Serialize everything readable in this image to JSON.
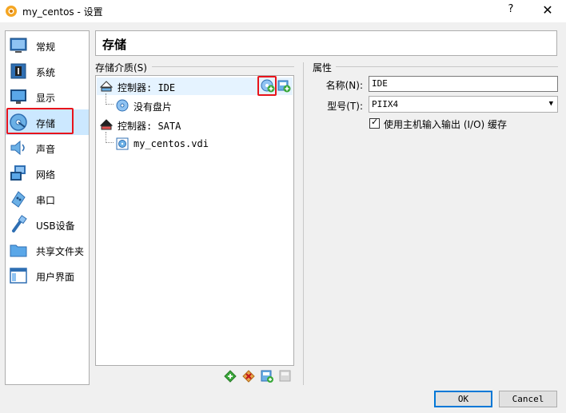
{
  "window": {
    "title": "my_centos - 设置",
    "help_label": "?",
    "close_label": "✕"
  },
  "sidebar": {
    "items": [
      {
        "label": "常规",
        "icon": "general-icon"
      },
      {
        "label": "系统",
        "icon": "system-chip-icon"
      },
      {
        "label": "显示",
        "icon": "display-monitor-icon"
      },
      {
        "label": "存储",
        "icon": "storage-disk-icon",
        "selected": true
      },
      {
        "label": "声音",
        "icon": "speaker-icon"
      },
      {
        "label": "网络",
        "icon": "network-icon"
      },
      {
        "label": "串口",
        "icon": "serial-port-icon"
      },
      {
        "label": "USB设备",
        "icon": "usb-icon"
      },
      {
        "label": "共享文件夹",
        "icon": "shared-folder-icon"
      },
      {
        "label": "用户界面",
        "icon": "user-interface-icon"
      }
    ]
  },
  "section": {
    "title": "存储"
  },
  "storage": {
    "group_label": "存储介质(S)",
    "tree": [
      {
        "label": "控制器: IDE",
        "type": "controller",
        "selected": true
      },
      {
        "label": "没有盘片",
        "type": "optical",
        "level": 1
      },
      {
        "label": "控制器: SATA",
        "type": "controller"
      },
      {
        "label": "my_centos.vdi",
        "type": "disk",
        "level": 1
      }
    ]
  },
  "properties": {
    "group_label": "属性",
    "name_label": "名称(N):",
    "name_value": "IDE",
    "type_label": "型号(T):",
    "type_value": "PIIX4",
    "host_io_label": "使用主机输入输出 (I/O) 缓存",
    "host_io_checked": true,
    "check_glyph": "✓"
  },
  "dialog": {
    "ok_label": "OK",
    "cancel_label": "Cancel"
  },
  "colors": {
    "highlight": "#e8141b",
    "selection": "#cce8ff",
    "default_button_border": "#0078d7"
  }
}
